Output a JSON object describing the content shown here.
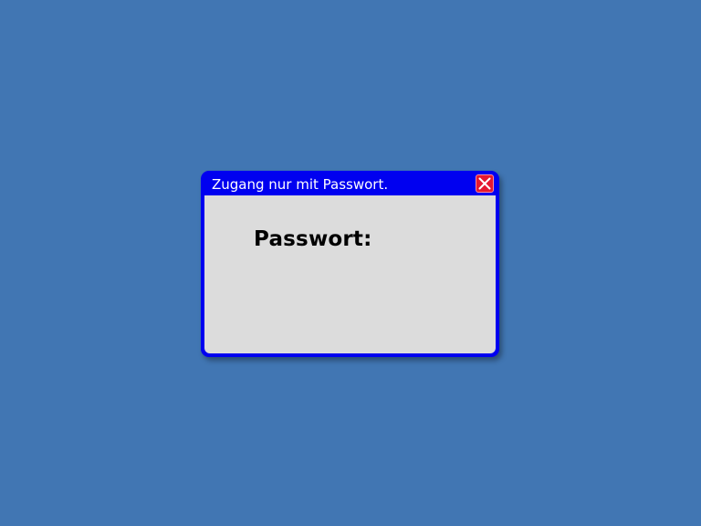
{
  "colors": {
    "desktop": "#4176b3",
    "window_frame": "#0000f0",
    "window_body": "#dcdcdc",
    "close_button": "#e51830"
  },
  "dialog": {
    "title": "Zugang nur mit Passwort.",
    "close_icon": "close-icon",
    "password_label": "Passwort:"
  }
}
